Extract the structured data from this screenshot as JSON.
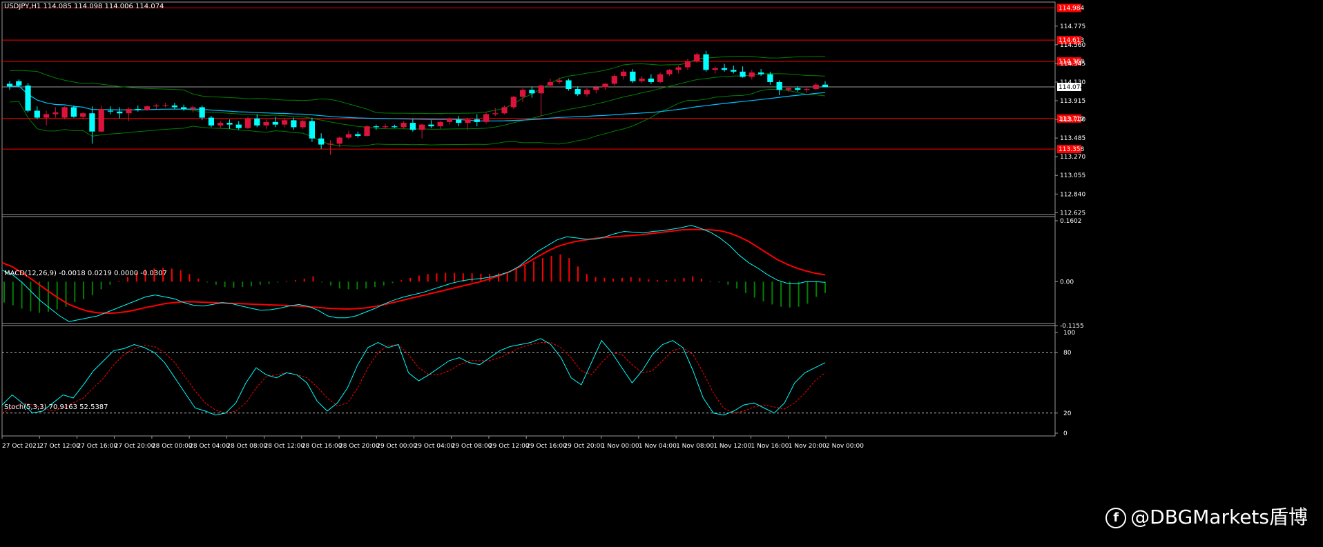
{
  "main_info": "USDJPY,H1  114.085 114.098 114.006 114.074",
  "macd_info": "MACD(12,26,9) -0.0018 0.0219 0.0000 -0.0307",
  "stoch_info": "Stoch(5,3,3) 70.9163 52.5387",
  "watermark": "@DBGMarkets盾博",
  "watermark_icon": "facebook-like-icon",
  "colors": {
    "background": "#000000",
    "bull": "#dc143c",
    "bear": "#00ffff",
    "band": "#008000",
    "ma": "#00bfff",
    "hline": "#ff0000",
    "macd_signal": "#ff0000",
    "macd_line": "#00ffff",
    "hist_pos": "#ff0000",
    "hist_neg": "#008000",
    "stoch_main": "#00ffff",
    "stoch_signal": "#ff0000"
  },
  "price_axis": {
    "ticks": [
      "114.775",
      "114.560",
      "114.345",
      "114.130",
      "113.915",
      "113.700",
      "113.485",
      "113.270",
      "113.055",
      "112.840",
      "112.625"
    ],
    "current": "114.074",
    "levels": [
      "114.984",
      "114.613",
      "114.368",
      "113.710",
      "113.358"
    ]
  },
  "macd_axis": {
    "ticks": [
      "0.1602",
      "0.00",
      "-0.1155"
    ]
  },
  "stoch_axis": {
    "ticks": [
      "100",
      "80",
      "20",
      "0"
    ]
  },
  "time_axis": {
    "labels": [
      "27 Oct 2021",
      "27 Oct 12:00",
      "27 Oct 16:00",
      "27 Oct 20:00",
      "28 Oct 00:00",
      "28 Oct 04:00",
      "28 Oct 08:00",
      "28 Oct 12:00",
      "28 Oct 16:00",
      "28 Oct 20:00",
      "29 Oct 00:00",
      "29 Oct 04:00",
      "29 Oct 08:00",
      "29 Oct 12:00",
      "29 Oct 16:00",
      "29 Oct 20:00",
      "1 Nov 00:00",
      "1 Nov 04:00",
      "1 Nov 08:00",
      "1 Nov 12:00",
      "1 Nov 16:00",
      "1 Nov 20:00",
      "2 Nov 00:00"
    ]
  },
  "chart_data": {
    "type": "candlestick",
    "symbol": "USDJPY",
    "timeframe": "H1",
    "ohlc": [
      [
        114.11,
        114.14,
        114.04,
        114.08
      ],
      [
        114.14,
        114.16,
        114.07,
        114.09
      ],
      [
        114.09,
        114.12,
        113.78,
        113.8
      ],
      [
        113.8,
        113.85,
        113.7,
        113.72
      ],
      [
        113.72,
        113.8,
        113.63,
        113.76
      ],
      [
        113.76,
        113.84,
        113.72,
        113.78
      ],
      [
        113.72,
        113.85,
        113.7,
        113.84
      ],
      [
        113.84,
        113.86,
        113.72,
        113.73
      ],
      [
        113.73,
        113.78,
        113.7,
        113.77
      ],
      [
        113.77,
        113.85,
        113.42,
        113.56
      ],
      [
        113.56,
        113.86,
        113.55,
        113.82
      ],
      [
        113.8,
        113.85,
        113.76,
        113.79
      ],
      [
        113.79,
        113.84,
        113.71,
        113.77
      ],
      [
        113.77,
        113.84,
        113.68,
        113.82
      ],
      [
        113.82,
        113.86,
        113.79,
        113.81
      ],
      [
        113.81,
        113.86,
        113.8,
        113.85
      ],
      [
        113.85,
        113.88,
        113.82,
        113.86
      ],
      [
        113.86,
        113.89,
        113.84,
        113.86
      ],
      [
        113.86,
        113.89,
        113.82,
        113.84
      ],
      [
        113.84,
        113.87,
        113.8,
        113.82
      ],
      [
        113.82,
        113.86,
        113.78,
        113.84
      ],
      [
        113.84,
        113.86,
        113.69,
        113.72
      ],
      [
        113.72,
        113.74,
        113.61,
        113.63
      ],
      [
        113.63,
        113.68,
        113.6,
        113.66
      ],
      [
        113.66,
        113.7,
        113.59,
        113.64
      ],
      [
        113.64,
        113.68,
        113.58,
        113.6
      ],
      [
        113.6,
        113.73,
        113.59,
        113.71
      ],
      [
        113.71,
        113.76,
        113.61,
        113.63
      ],
      [
        113.63,
        113.7,
        113.59,
        113.67
      ],
      [
        113.67,
        113.73,
        113.61,
        113.64
      ],
      [
        113.64,
        113.71,
        113.61,
        113.69
      ],
      [
        113.69,
        113.72,
        113.58,
        113.61
      ],
      [
        113.61,
        113.7,
        113.59,
        113.68
      ],
      [
        113.68,
        113.72,
        113.44,
        113.48
      ],
      [
        113.48,
        113.54,
        113.36,
        113.41
      ],
      [
        113.41,
        113.46,
        113.29,
        113.42
      ],
      [
        113.42,
        113.5,
        113.38,
        113.49
      ],
      [
        113.49,
        113.57,
        113.47,
        113.53
      ],
      [
        113.53,
        113.56,
        113.49,
        113.51
      ],
      [
        113.51,
        113.63,
        113.5,
        113.62
      ],
      [
        113.62,
        113.64,
        113.58,
        113.61
      ],
      [
        113.61,
        113.65,
        113.59,
        113.62
      ],
      [
        113.62,
        113.64,
        113.6,
        113.61
      ],
      [
        113.61,
        113.68,
        113.59,
        113.66
      ],
      [
        113.66,
        113.7,
        113.56,
        113.58
      ],
      [
        113.58,
        113.65,
        113.48,
        113.64
      ],
      [
        113.64,
        113.69,
        113.6,
        113.62
      ],
      [
        113.62,
        113.68,
        113.59,
        113.67
      ],
      [
        113.67,
        113.72,
        113.64,
        113.7
      ],
      [
        113.7,
        113.74,
        113.62,
        113.66
      ],
      [
        113.66,
        113.72,
        113.58,
        113.7
      ],
      [
        113.7,
        113.76,
        113.62,
        113.67
      ],
      [
        113.67,
        113.78,
        113.65,
        113.76
      ],
      [
        113.76,
        113.83,
        113.74,
        113.77
      ],
      [
        113.77,
        113.86,
        113.76,
        113.84
      ],
      [
        113.84,
        113.97,
        113.82,
        113.96
      ],
      [
        113.96,
        114.06,
        113.9,
        114.04
      ],
      [
        114.04,
        114.08,
        113.95,
        114.0
      ],
      [
        114.0,
        114.1,
        113.74,
        114.09
      ],
      [
        114.09,
        114.17,
        114.07,
        114.13
      ],
      [
        114.13,
        114.18,
        114.11,
        114.15
      ],
      [
        114.15,
        114.17,
        114.03,
        114.05
      ],
      [
        114.05,
        114.08,
        113.97,
        113.99
      ],
      [
        113.99,
        114.06,
        113.96,
        114.04
      ],
      [
        114.04,
        114.09,
        114.0,
        114.07
      ],
      [
        114.07,
        114.12,
        114.04,
        114.11
      ],
      [
        114.11,
        114.22,
        114.09,
        114.2
      ],
      [
        114.2,
        114.28,
        114.16,
        114.25
      ],
      [
        114.25,
        114.28,
        114.12,
        114.14
      ],
      [
        114.14,
        114.2,
        114.12,
        114.17
      ],
      [
        114.17,
        114.22,
        114.11,
        114.13
      ],
      [
        114.13,
        114.24,
        114.12,
        114.22
      ],
      [
        114.22,
        114.28,
        114.2,
        114.27
      ],
      [
        114.27,
        114.32,
        114.23,
        114.3
      ],
      [
        114.3,
        114.4,
        114.27,
        114.37
      ],
      [
        114.37,
        114.47,
        114.35,
        114.45
      ],
      [
        114.45,
        114.49,
        114.25,
        114.27
      ],
      [
        114.27,
        114.31,
        114.23,
        114.29
      ],
      [
        114.29,
        114.34,
        114.25,
        114.27
      ],
      [
        114.27,
        114.32,
        114.23,
        114.25
      ],
      [
        114.25,
        114.31,
        114.18,
        114.19
      ],
      [
        114.19,
        114.27,
        114.16,
        114.24
      ],
      [
        114.24,
        114.28,
        114.2,
        114.22
      ],
      [
        114.22,
        114.25,
        114.1,
        114.13
      ],
      [
        114.13,
        114.15,
        113.98,
        114.04
      ],
      [
        114.04,
        114.08,
        114.01,
        114.06
      ],
      [
        114.06,
        114.08,
        114.02,
        114.04
      ],
      [
        114.04,
        114.08,
        114.01,
        114.05
      ],
      [
        114.05,
        114.12,
        114.04,
        114.1
      ],
      [
        114.1,
        114.14,
        114.08,
        114.07
      ]
    ],
    "levels": [
      114.984,
      114.613,
      114.368,
      113.71,
      113.358
    ],
    "current_price": 114.074,
    "ylim": [
      112.58,
      114.98
    ],
    "macd": {
      "params": "12,26,9",
      "ylim": [
        -0.1155,
        0.1602
      ],
      "histogram": [
        -0.055,
        -0.062,
        -0.071,
        -0.078,
        -0.082,
        -0.079,
        -0.073,
        -0.066,
        -0.054,
        -0.046,
        -0.036,
        -0.02,
        -0.008,
        0.002,
        0.012,
        0.024,
        0.032,
        0.035,
        0.036,
        0.034,
        0.03,
        0.02,
        0.008,
        -0.002,
        -0.008,
        -0.014,
        -0.016,
        -0.014,
        -0.012,
        -0.008,
        -0.006,
        -0.002,
        0.002,
        0.004,
        0.008,
        0.014,
        -0.002,
        -0.01,
        -0.018,
        -0.02,
        -0.02,
        -0.018,
        -0.014,
        -0.01,
        -0.004,
        0.004,
        0.01,
        0.016,
        0.02,
        0.022,
        0.023,
        0.023,
        0.022,
        0.022,
        0.021,
        0.02,
        0.022,
        0.026,
        0.034,
        0.044,
        0.054,
        0.062,
        0.068,
        0.072,
        0.062,
        0.04,
        0.02,
        0.012,
        0.01,
        0.008,
        0.01,
        0.012,
        0.01,
        0.006,
        0.004,
        0.004,
        0.006,
        0.01,
        0.014,
        0.008,
        0.002,
        -0.002,
        -0.008,
        -0.018,
        -0.03,
        -0.042,
        -0.052,
        -0.06,
        -0.066,
        -0.068,
        -0.066,
        -0.058,
        -0.04,
        -0.03
      ],
      "macd": [
        0.03,
        0.02,
        0.0,
        -0.025,
        -0.05,
        -0.07,
        -0.09,
        -0.105,
        -0.1,
        -0.095,
        -0.09,
        -0.08,
        -0.07,
        -0.06,
        -0.05,
        -0.04,
        -0.035,
        -0.04,
        -0.045,
        -0.055,
        -0.062,
        -0.064,
        -0.06,
        -0.055,
        -0.058,
        -0.064,
        -0.07,
        -0.075,
        -0.074,
        -0.07,
        -0.064,
        -0.06,
        -0.065,
        -0.075,
        -0.09,
        -0.095,
        -0.095,
        -0.09,
        -0.08,
        -0.07,
        -0.058,
        -0.048,
        -0.04,
        -0.034,
        -0.028,
        -0.02,
        -0.012,
        -0.004,
        0.002,
        0.006,
        0.008,
        0.012,
        0.018,
        0.026,
        0.04,
        0.06,
        0.08,
        0.095,
        0.11,
        0.118,
        0.115,
        0.112,
        0.112,
        0.118,
        0.126,
        0.132,
        0.13,
        0.128,
        0.132,
        0.134,
        0.138,
        0.142,
        0.148,
        0.14,
        0.13,
        0.115,
        0.095,
        0.07,
        0.05,
        0.035,
        0.018,
        0.004,
        -0.004,
        -0.006,
        0.0,
        0.0,
        -0.002
      ],
      "signal": [
        0.05,
        0.04,
        0.025,
        0.008,
        -0.01,
        -0.028,
        -0.045,
        -0.06,
        -0.07,
        -0.078,
        -0.082,
        -0.083,
        -0.082,
        -0.079,
        -0.074,
        -0.068,
        -0.063,
        -0.058,
        -0.055,
        -0.053,
        -0.053,
        -0.054,
        -0.055,
        -0.056,
        -0.057,
        -0.058,
        -0.059,
        -0.06,
        -0.061,
        -0.062,
        -0.063,
        -0.064,
        -0.066,
        -0.068,
        -0.07,
        -0.071,
        -0.072,
        -0.071,
        -0.069,
        -0.065,
        -0.06,
        -0.054,
        -0.048,
        -0.042,
        -0.036,
        -0.03,
        -0.024,
        -0.018,
        -0.012,
        -0.006,
        0.0,
        0.008,
        0.016,
        0.026,
        0.038,
        0.052,
        0.066,
        0.08,
        0.092,
        0.1,
        0.106,
        0.11,
        0.114,
        0.116,
        0.118,
        0.12,
        0.122,
        0.124,
        0.127,
        0.13,
        0.133,
        0.136,
        0.137,
        0.137,
        0.136,
        0.134,
        0.128,
        0.118,
        0.106,
        0.09,
        0.074,
        0.058,
        0.046,
        0.036,
        0.028,
        0.022,
        0.018
      ]
    },
    "stochastic": {
      "params": "5,3,3",
      "ylim": [
        0,
        100
      ],
      "levels": [
        80,
        20
      ],
      "main": [
        28,
        38,
        30,
        20,
        22,
        30,
        38,
        35,
        48,
        62,
        72,
        82,
        84,
        88,
        85,
        80,
        70,
        55,
        40,
        25,
        22,
        18,
        20,
        30,
        50,
        65,
        58,
        55,
        60,
        58,
        50,
        32,
        22,
        30,
        45,
        68,
        85,
        90,
        85,
        88,
        60,
        52,
        58,
        65,
        72,
        75,
        70,
        68,
        75,
        82,
        86,
        88,
        90,
        94,
        88,
        75,
        55,
        48,
        70,
        92,
        80,
        65,
        50,
        62,
        78,
        88,
        92,
        85,
        62,
        35,
        20,
        18,
        22,
        28,
        30,
        25,
        20,
        30,
        50,
        60,
        65,
        70
      ],
      "signal": [
        20,
        25,
        30,
        28,
        25,
        22,
        25,
        30,
        35,
        45,
        55,
        68,
        78,
        84,
        87,
        86,
        80,
        70,
        56,
        42,
        30,
        23,
        20,
        22,
        30,
        45,
        56,
        58,
        60,
        58,
        55,
        46,
        35,
        27,
        30,
        45,
        65,
        80,
        87,
        88,
        78,
        65,
        58,
        58,
        62,
        68,
        72,
        72,
        72,
        75,
        80,
        85,
        88,
        90,
        90,
        85,
        75,
        62,
        58,
        70,
        80,
        78,
        68,
        60,
        62,
        72,
        82,
        85,
        78,
        60,
        40,
        25,
        20,
        22,
        26,
        28,
        26,
        24,
        30,
        40,
        52,
        60
      ]
    }
  }
}
